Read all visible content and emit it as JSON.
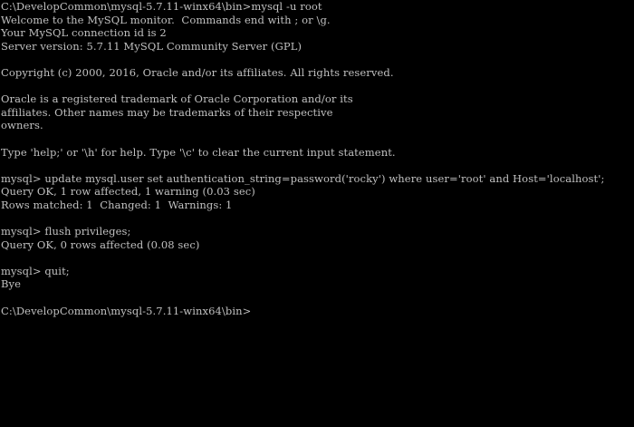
{
  "terminal": {
    "background": "#000000",
    "foreground": "#c0c0c0",
    "lines": [
      "C:\\DevelopCommon\\mysql-5.7.11-winx64\\bin>mysql -u root",
      "Welcome to the MySQL monitor.  Commands end with ; or \\g.",
      "Your MySQL connection id is 2",
      "Server version: 5.7.11 MySQL Community Server (GPL)",
      "",
      "Copyright (c) 2000, 2016, Oracle and/or its affiliates. All rights reserved.",
      "",
      "Oracle is a registered trademark of Oracle Corporation and/or its",
      "affiliates. Other names may be trademarks of their respective",
      "owners.",
      "",
      "Type 'help;' or '\\h' for help. Type '\\c' to clear the current input statement.",
      "",
      "mysql> update mysql.user set authentication_string=password('rocky') where user='root' and Host='localhost';",
      "Query OK, 1 row affected, 1 warning (0.03 sec)",
      "Rows matched: 1  Changed: 1  Warnings: 1",
      "",
      "mysql> flush privileges;",
      "Query OK, 0 rows affected (0.08 sec)",
      "",
      "mysql> quit;",
      "Bye",
      "",
      "C:\\DevelopCommon\\mysql-5.7.11-winx64\\bin>"
    ]
  }
}
